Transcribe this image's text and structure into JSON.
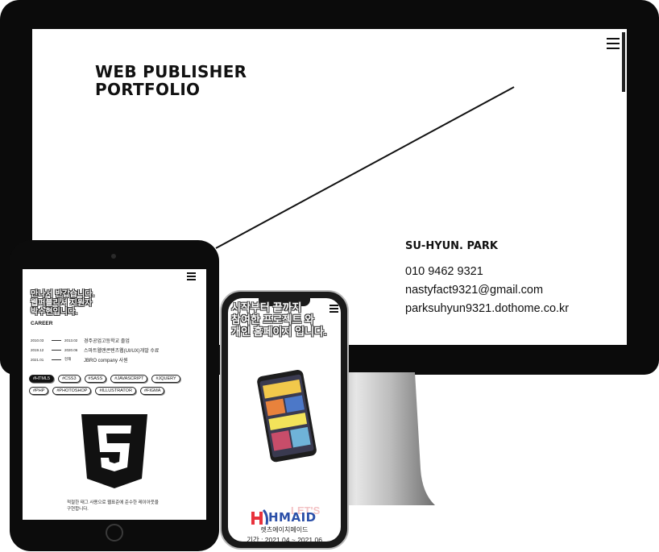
{
  "desktop": {
    "title_line1": "WEB PUBLISHER",
    "title_line2": "PORTFOLIO",
    "name": "SU-HYUN. PARK",
    "phone": "010 9462 9321",
    "email": "nastyfact9321@gmail.com",
    "website": "parksuhyun9321.dothome.co.kr"
  },
  "tablet": {
    "hero_line1": "만나서 반갑습니다.",
    "hero_line2": "웹퍼블리셔 지원자",
    "hero_line3": "박수현입니다.",
    "career_heading": "CAREER",
    "career": [
      {
        "start": "2010.03",
        "end": "2013.02",
        "desc": "경주공업고등학교 졸업"
      },
      {
        "start": "2019.12",
        "end": "2020.06",
        "desc": "스마트웹앤콘텐츠웹(UI/UX)개발 수료"
      },
      {
        "start": "2021.01",
        "end": "현재",
        "desc": "JBRO company 사원"
      }
    ],
    "tags": [
      "#HTML5",
      "#CSS3",
      "#SASS",
      "#JAVASCRIPT",
      "#JQUERY",
      "#PHP",
      "#PHOTOSHOP",
      "#ILLUSTRATOR",
      "#FIGMA"
    ],
    "html5_caption_line1": "적절한 태그 사용으로 웹표준에 준수한 레이아웃을",
    "html5_caption_line2": "구현합니다."
  },
  "phone": {
    "hero_line1": "시작부터 끝까지",
    "hero_line2": "참여한 프로젝트 와",
    "hero_line3": "개인 홈페이지 입니다.",
    "brand_overlay": "LET'S",
    "brand": "HMAID",
    "project_name": "렛츠에이치메이드",
    "period": "기간 : 2021.04 ~ 2021.06"
  },
  "colors": {
    "device_black": "#0b0b0b",
    "brand_red": "#e8323c",
    "brand_blue": "#2b4fa8"
  }
}
